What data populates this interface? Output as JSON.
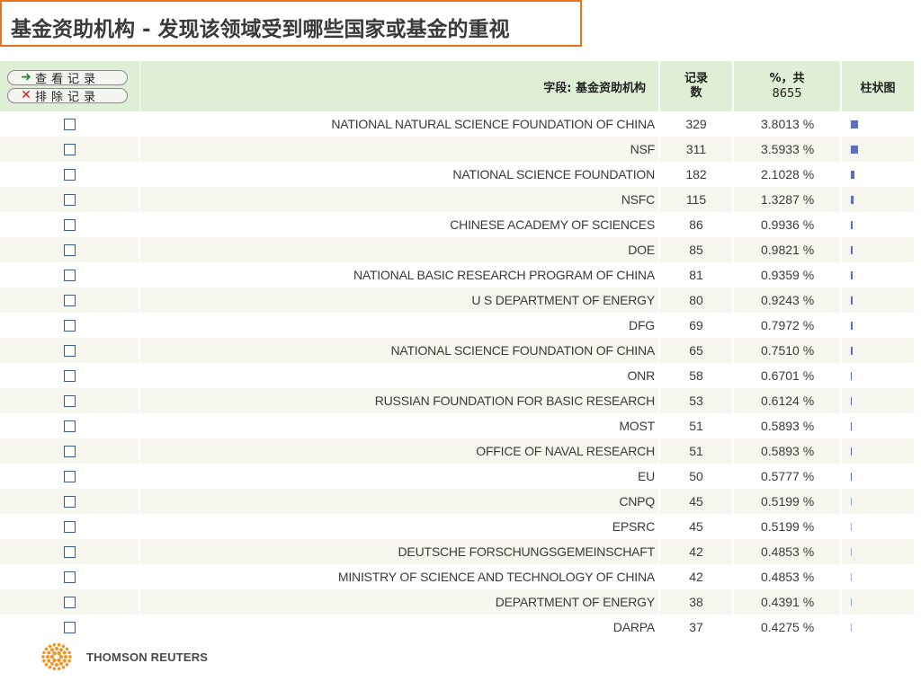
{
  "title": "基金资助机构 - 发现该领域受到哪些国家或基金的重视",
  "actions": {
    "view_label": "查看记录",
    "exclude_label": "排除记录"
  },
  "header": {
    "field_label": "字段: 基金资助机构",
    "count_label_line1": "记录",
    "count_label_line2": "数",
    "pct_label_line1": "%，共",
    "pct_total": "8655",
    "bar_label": "柱状图"
  },
  "colors": {
    "title_border": "#e8731f",
    "header_bg": "#dfefd6",
    "bar": "#5b6fc0"
  },
  "rows": [
    {
      "name": "NATIONAL NATURAL SCIENCE FOUNDATION OF CHINA",
      "count": "329",
      "pct": "3.8013 %"
    },
    {
      "name": "NSF",
      "count": "311",
      "pct": "3.5933 %"
    },
    {
      "name": "NATIONAL SCIENCE FOUNDATION",
      "count": "182",
      "pct": "2.1028 %"
    },
    {
      "name": "NSFC",
      "count": "115",
      "pct": "1.3287 %"
    },
    {
      "name": "CHINESE ACADEMY OF SCIENCES",
      "count": "86",
      "pct": "0.9936 %"
    },
    {
      "name": "DOE",
      "count": "85",
      "pct": "0.9821 %"
    },
    {
      "name": "NATIONAL BASIC RESEARCH PROGRAM OF CHINA",
      "count": "81",
      "pct": "0.9359 %"
    },
    {
      "name": "U S DEPARTMENT OF ENERGY",
      "count": "80",
      "pct": "0.9243 %"
    },
    {
      "name": "DFG",
      "count": "69",
      "pct": "0.7972 %"
    },
    {
      "name": "NATIONAL SCIENCE FOUNDATION OF CHINA",
      "count": "65",
      "pct": "0.7510 %"
    },
    {
      "name": "ONR",
      "count": "58",
      "pct": "0.6701 %"
    },
    {
      "name": "RUSSIAN FOUNDATION FOR BASIC RESEARCH",
      "count": "53",
      "pct": "0.6124 %"
    },
    {
      "name": "MOST",
      "count": "51",
      "pct": "0.5893 %"
    },
    {
      "name": "OFFICE OF NAVAL RESEARCH",
      "count": "51",
      "pct": "0.5893 %"
    },
    {
      "name": "EU",
      "count": "50",
      "pct": "0.5777 %"
    },
    {
      "name": "CNPQ",
      "count": "45",
      "pct": "0.5199 %"
    },
    {
      "name": "EPSRC",
      "count": "45",
      "pct": "0.5199 %"
    },
    {
      "name": "DEUTSCHE FORSCHUNGSGEMEINSCHAFT",
      "count": "42",
      "pct": "0.4853 %"
    },
    {
      "name": "MINISTRY OF SCIENCE AND TECHNOLOGY OF CHINA",
      "count": "42",
      "pct": "0.4853 %"
    },
    {
      "name": "DEPARTMENT OF ENERGY",
      "count": "38",
      "pct": "0.4391 %"
    },
    {
      "name": "DARPA",
      "count": "37",
      "pct": "0.4275 %"
    }
  ],
  "logo_text": "THOMSON REUTERS"
}
